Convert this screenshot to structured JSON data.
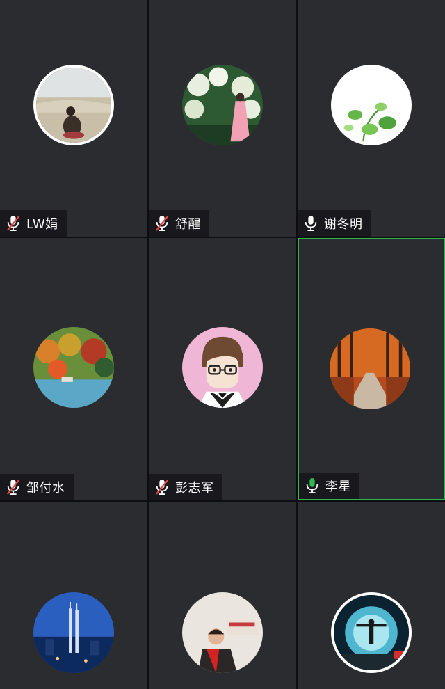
{
  "participants": [
    {
      "name": "LW娟",
      "mic": "muted",
      "avatar": "desert-photo"
    },
    {
      "name": "舒醒",
      "mic": "muted",
      "avatar": "flower-garden-photo"
    },
    {
      "name": "谢冬明",
      "mic": "on",
      "avatar": "green-leaves-illustration"
    },
    {
      "name": "邹付水",
      "mic": "muted",
      "avatar": "autumn-lake-photo"
    },
    {
      "name": "彭志军",
      "mic": "muted",
      "avatar": "cartoon-boy"
    },
    {
      "name": "李星",
      "mic": "speaking",
      "avatar": "autumn-road-photo"
    },
    {
      "name": "",
      "mic": "",
      "avatar": "city-towers-night-photo"
    },
    {
      "name": "",
      "mic": "",
      "avatar": "man-red-scarf-photo"
    },
    {
      "name": "",
      "mic": "",
      "avatar": "silhouette-glow-photo"
    }
  ],
  "colors": {
    "tile": "#2a2c30",
    "speaking_border": "#2fb74f",
    "mic_muted": "#e94343",
    "mic_speaking": "#2fb74f",
    "mic_on": "#ffffff"
  }
}
